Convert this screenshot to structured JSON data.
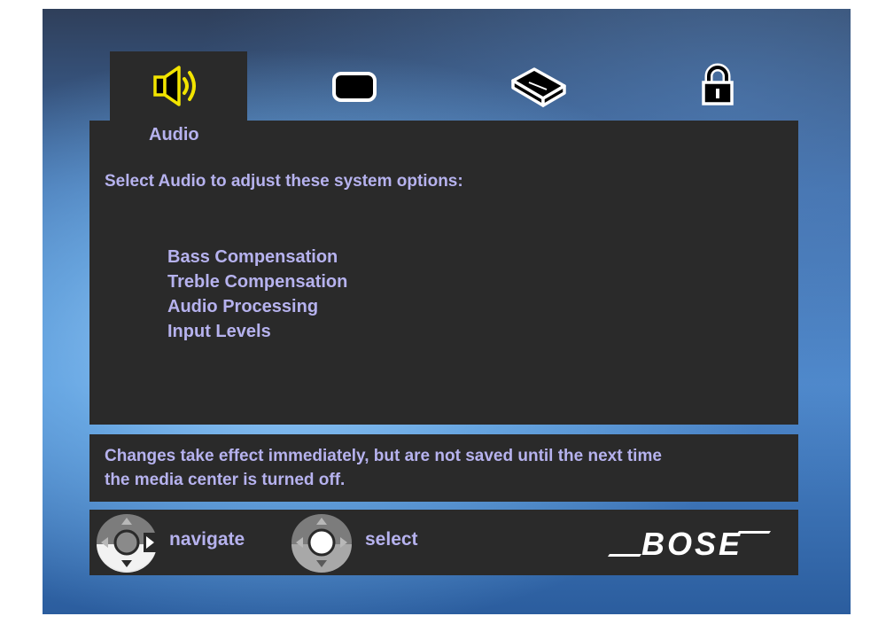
{
  "tabs": [
    {
      "icon": "speaker-icon",
      "label": "Audio",
      "active": true
    },
    {
      "icon": "display-icon",
      "active": false
    },
    {
      "icon": "media-player-icon",
      "active": false
    },
    {
      "icon": "lock-icon",
      "active": false
    }
  ],
  "panel": {
    "title": "Audio",
    "intro": "Select Audio to adjust these system options:",
    "options": [
      "Bass Compensation",
      "Treble Compensation",
      "Audio Processing",
      "Input Levels"
    ]
  },
  "notice": {
    "line1": "Changes take effect immediately, but are not saved until the next time",
    "line2": "the media center is turned off."
  },
  "footer": {
    "navigate_label": "navigate",
    "select_label": "select",
    "brand": "BOSE"
  },
  "colors": {
    "panel_background": "#2a2a2a",
    "text": "#b6b2ee",
    "active_icon": "#f2e400",
    "inactive_icon": "#ffffff"
  }
}
